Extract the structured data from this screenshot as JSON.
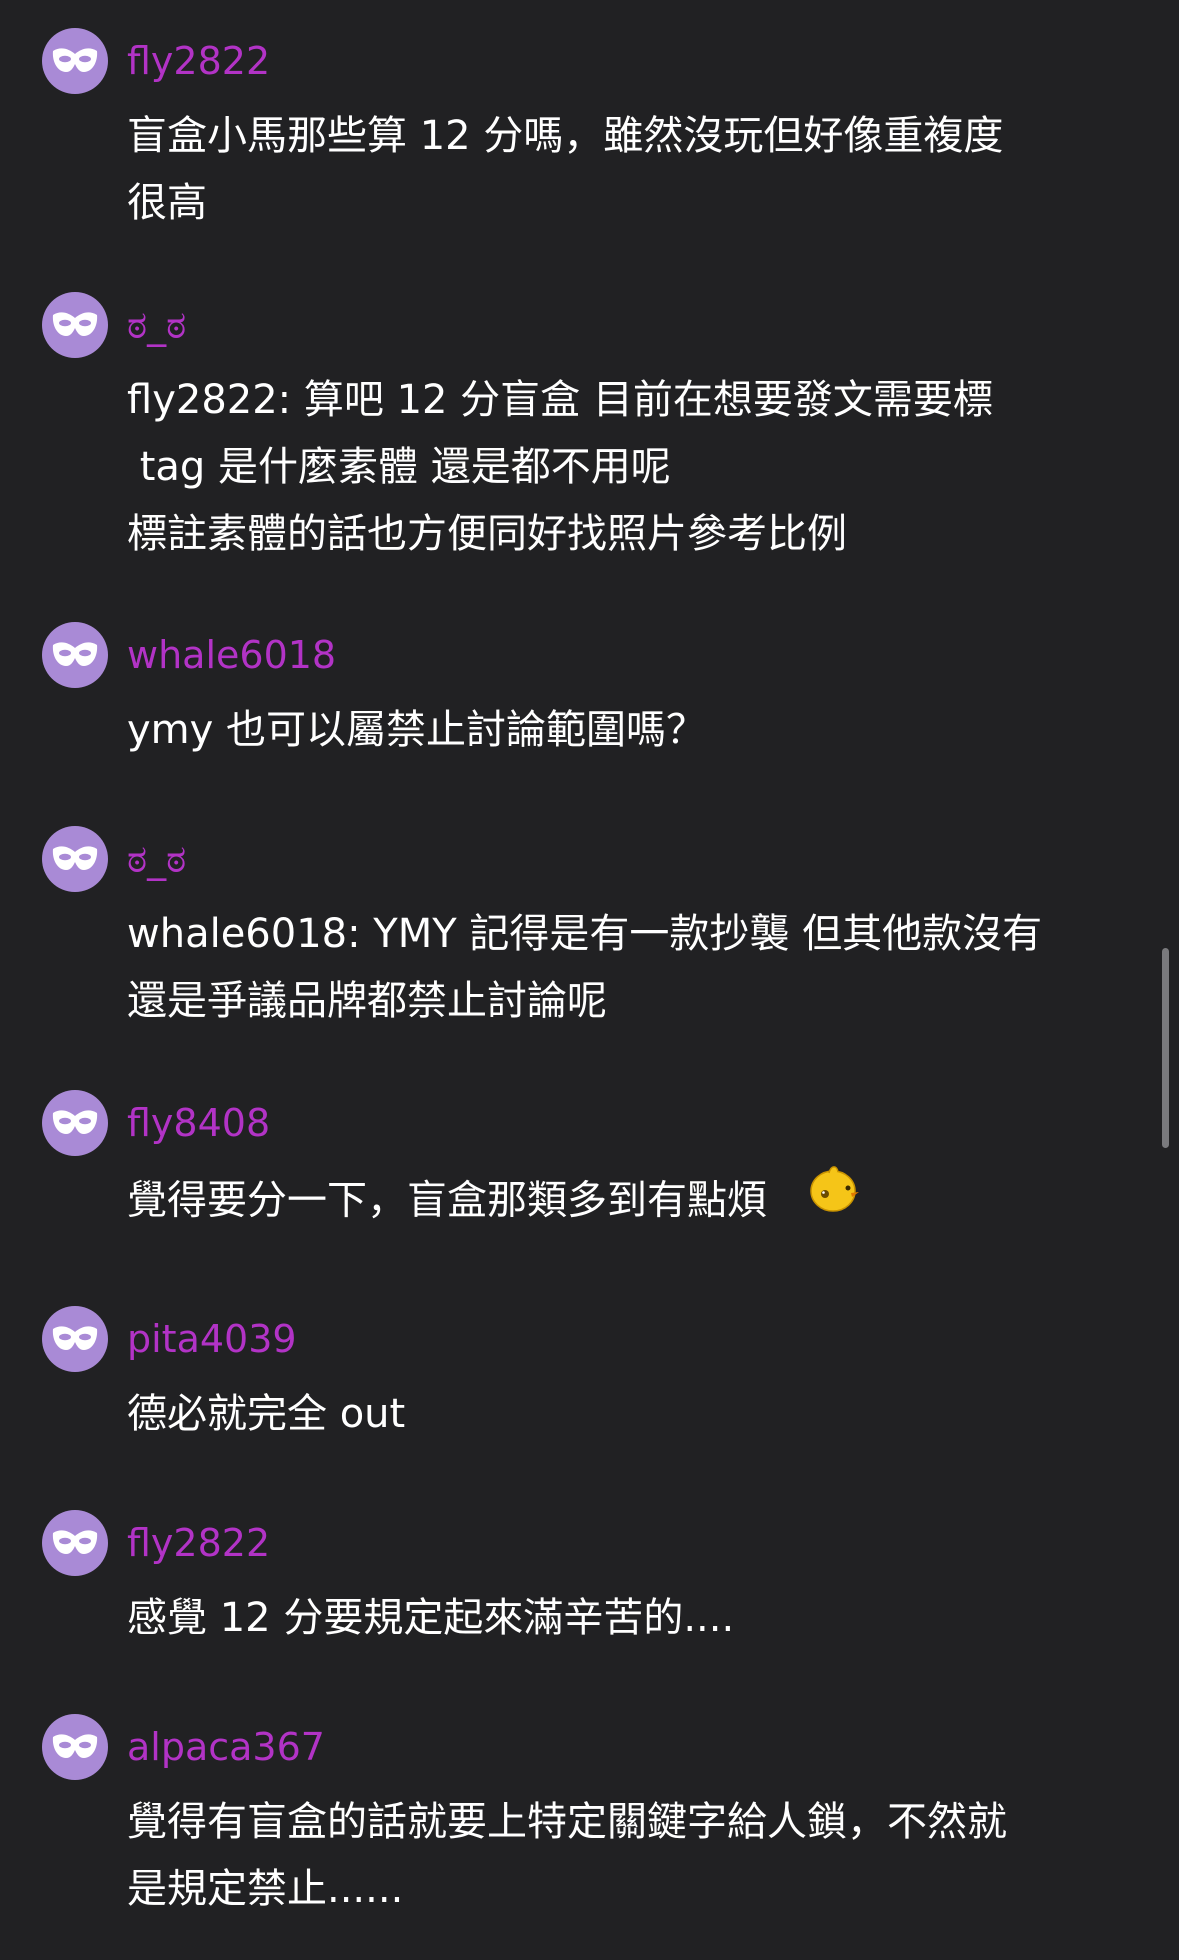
{
  "colors": {
    "background": "#212123",
    "username": "#b233c6",
    "avatar": "#a98ad6",
    "text": "#ffffff",
    "scrollbar": "#7a7a7d"
  },
  "avatar_icon": "anonymous-mask-icon",
  "emoji_icon": "yellow-chick-emoji",
  "comments": [
    {
      "user": "fly2822",
      "lines": [
        "盲盒小馬那些算 12 分嗎，雖然沒玩但好像重複度",
        "很高"
      ]
    },
    {
      "user": "ಠ_ಠ",
      "lines": [
        "fly2822: 算吧 12 分盲盒 目前在想要發文需要標",
        " tag 是什麼素體 還是都不用呢",
        "標註素體的話也方便同好找照片參考比例"
      ]
    },
    {
      "user": "whale6018",
      "lines": [
        "ymy 也可以屬禁止討論範圍嗎？"
      ]
    },
    {
      "user": "ಠ_ಠ",
      "lines": [
        "whale6018: YMY 記得是有一款抄襲 但其他款沒有",
        "還是爭議品牌都禁止討論呢"
      ]
    },
    {
      "user": "fly8408",
      "lines": [
        "覺得要分一下，盲盒那類多到有點煩"
      ]
    },
    {
      "user": "pita4039",
      "lines": [
        "德必就完全 out"
      ]
    },
    {
      "user": "fly2822",
      "lines": [
        "感覺 12 分要規定起來滿辛苦的...."
      ]
    },
    {
      "user": "alpaca367",
      "lines": [
        "覺得有盲盒的話就要上特定關鍵字給人鎖，不然就",
        "是規定禁止......"
      ]
    }
  ]
}
